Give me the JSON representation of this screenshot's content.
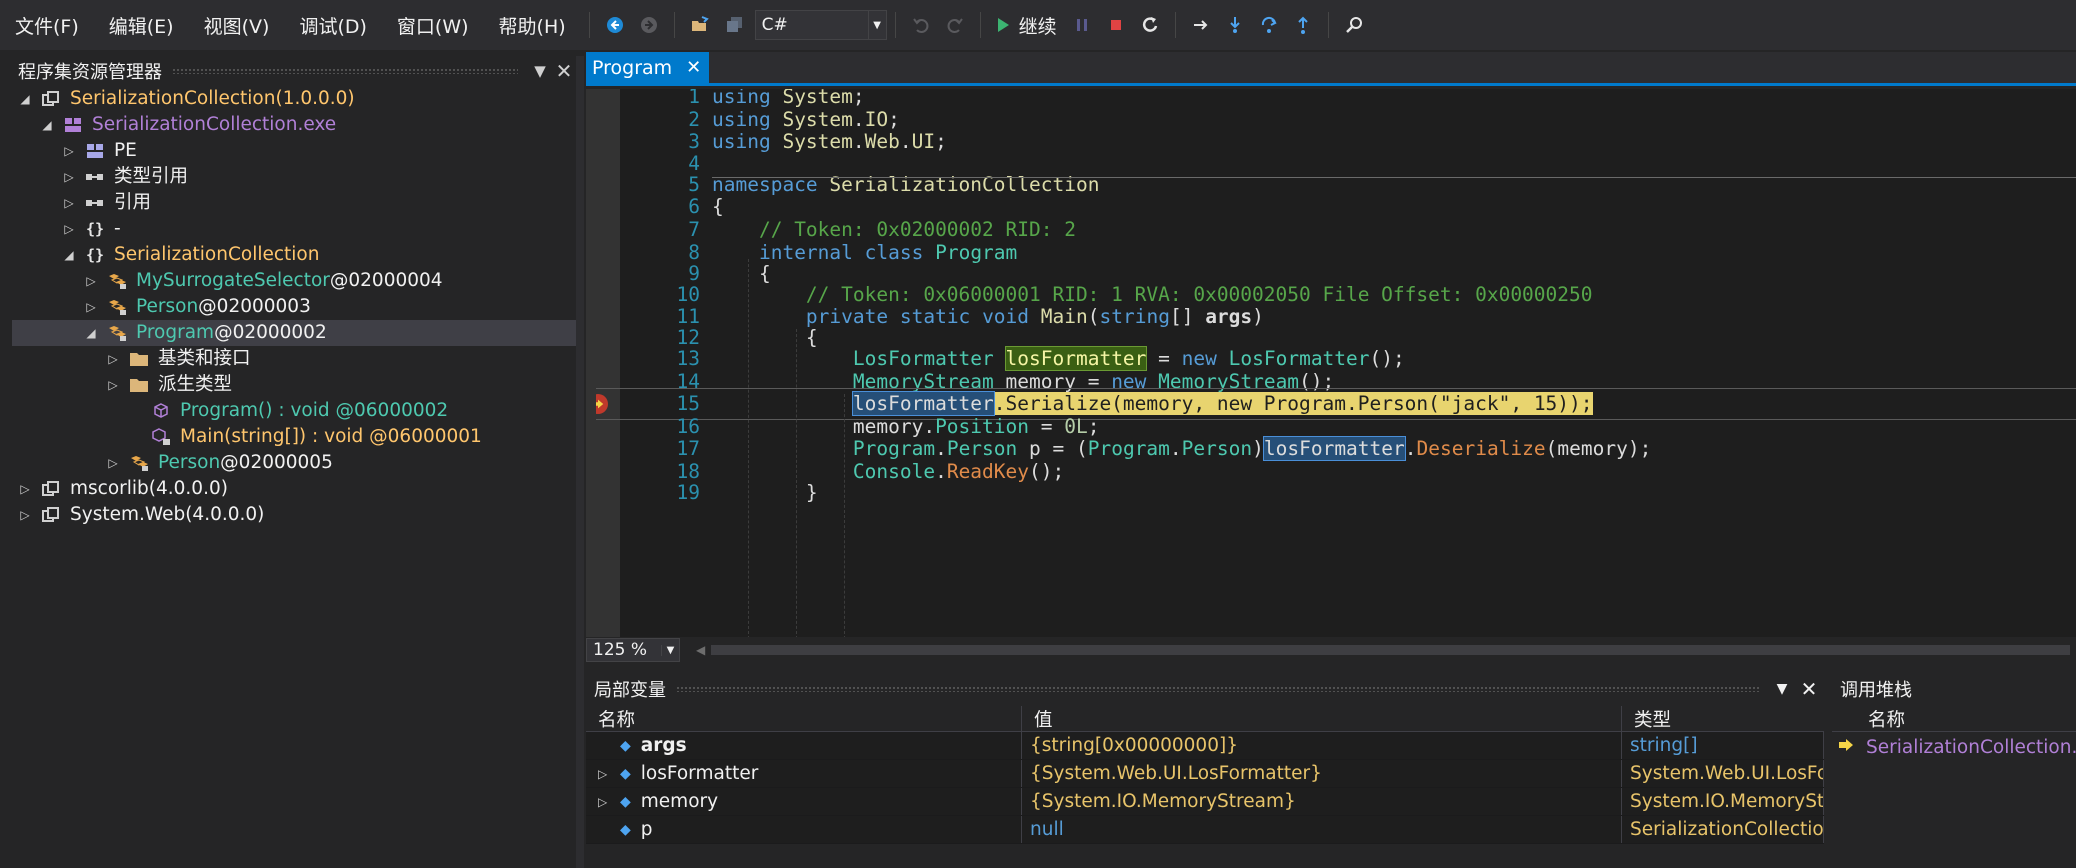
{
  "menu": [
    "文件(F)",
    "编辑(E)",
    "视图(V)",
    "调试(D)",
    "窗口(W)",
    "帮助(H)"
  ],
  "toolbar": {
    "language": "C#",
    "continue_label": "继续",
    "icons": [
      "back-icon",
      "forward-icon",
      "open-icon",
      "save-icon",
      "undo-icon",
      "redo-icon",
      "play-icon",
      "pause-icon",
      "stop-icon",
      "restart-icon",
      "show-next-statement-icon",
      "step-into-icon",
      "step-over-icon",
      "step-out-icon",
      "search-icon"
    ]
  },
  "explorer": {
    "title": "程序集资源管理器",
    "nodes": [
      {
        "text": "SerializationCollection",
        "suffix": " (1.0.0.0)",
        "level": 0,
        "expanded": true,
        "icon": "assembly-icon",
        "color": "orange"
      },
      {
        "text": "SerializationCollection.exe",
        "suffix": "",
        "level": 1,
        "expanded": true,
        "icon": "module-icon",
        "color": "purple"
      },
      {
        "text": "PE",
        "suffix": "",
        "level": 2,
        "expanded": false,
        "icon": "pe-icon",
        "color": "white"
      },
      {
        "text": "类型引用",
        "suffix": "",
        "level": 2,
        "expanded": false,
        "icon": "type-ref-icon",
        "color": "white"
      },
      {
        "text": "引用",
        "suffix": "",
        "level": 2,
        "expanded": false,
        "icon": "reference-icon",
        "color": "white"
      },
      {
        "text": "-",
        "suffix": "",
        "level": 2,
        "expanded": false,
        "icon": "namespace-icon",
        "color": "white"
      },
      {
        "text": "SerializationCollection",
        "suffix": "",
        "level": 2,
        "expanded": true,
        "icon": "namespace-icon",
        "color": "orange"
      },
      {
        "text": "MySurrogateSelector",
        "suffix": " @02000004",
        "level": 3,
        "expanded": false,
        "icon": "class-icon",
        "color": "teal"
      },
      {
        "text": "Person",
        "suffix": " @02000003",
        "level": 3,
        "expanded": false,
        "icon": "class-icon",
        "color": "teal"
      },
      {
        "text": "Program",
        "suffix": " @02000002",
        "level": 3,
        "expanded": true,
        "icon": "class-icon",
        "color": "teal",
        "selected": true
      },
      {
        "text": "基类和接口",
        "suffix": "",
        "level": 4,
        "expanded": false,
        "icon": "folder-icon",
        "color": "white"
      },
      {
        "text": "派生类型",
        "suffix": "",
        "level": 4,
        "expanded": false,
        "icon": "folder-icon",
        "color": "white"
      },
      {
        "text": "Program() : void @06000002",
        "suffix": "",
        "level": 5,
        "expanded": null,
        "icon": "method-icon",
        "color": "teal"
      },
      {
        "text": "Main(string[]) : void @06000001",
        "suffix": "",
        "level": 5,
        "expanded": null,
        "icon": "private-method-icon",
        "color": "orange"
      },
      {
        "text": "Person",
        "suffix": " @02000005",
        "level": 4,
        "expanded": false,
        "icon": "class-icon",
        "color": "teal"
      },
      {
        "text": "mscorlib",
        "suffix": " (4.0.0.0)",
        "level": 0,
        "expanded": false,
        "icon": "assembly-icon",
        "color": "white"
      },
      {
        "text": "System.Web",
        "suffix": " (4.0.0.0)",
        "level": 0,
        "expanded": false,
        "icon": "assembly-icon",
        "color": "white"
      }
    ]
  },
  "editor": {
    "tab": "Program",
    "zoom": "125 %",
    "line_numbers": [
      "1",
      "2",
      "3",
      "4",
      "5",
      "6",
      "7",
      "8",
      "9",
      "10",
      "11",
      "12",
      "13",
      "14",
      "15",
      "16",
      "17",
      "18",
      "19"
    ],
    "current_line": 15
  },
  "locals": {
    "title": "局部变量",
    "columns": [
      "名称",
      "值",
      "类型"
    ],
    "rows": [
      {
        "name": "args",
        "value": "{string[0x00000000]}",
        "type": "string[]",
        "expandable": false
      },
      {
        "name": "losFormatter",
        "value": "{System.Web.UI.LosFormatter}",
        "type": "System.Web.UI.LosFormatter",
        "expandable": true
      },
      {
        "name": "memory",
        "value": "{System.IO.MemoryStream}",
        "type": "System.IO.MemoryStream",
        "expandable": true
      },
      {
        "name": "p",
        "value": "null",
        "type": "SerializationCollection.Program.Person",
        "expandable": false
      }
    ]
  },
  "callstack": {
    "title": "调用堆栈",
    "column": "名称",
    "frames": [
      "SerializationCollection.exe!SerializationCollection.Program.Main"
    ]
  },
  "colors": {
    "accent": "#007acc",
    "background": "#1e1e1e",
    "current_line": "#e8d46f"
  }
}
